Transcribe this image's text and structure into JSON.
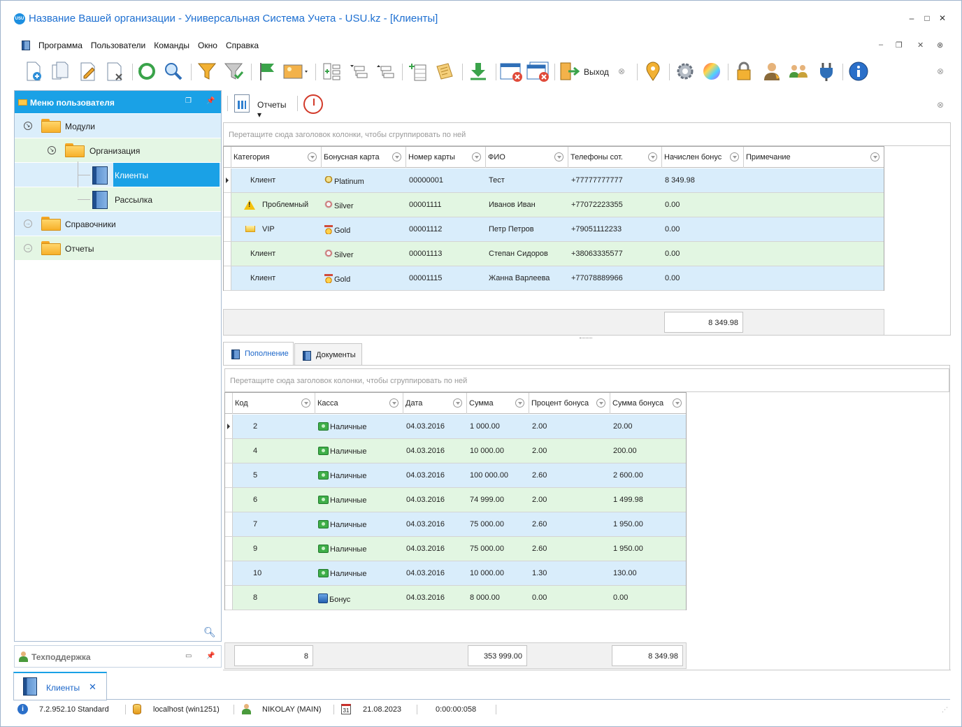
{
  "window": {
    "title": "Название Вашей организации - Универсальная Система Учета - USU.kz - [Клиенты]",
    "logo_text": "USU"
  },
  "menu": {
    "items": [
      "Программа",
      "Пользователи",
      "Команды",
      "Окно",
      "Справка"
    ]
  },
  "toolbar": {
    "icons": [
      "add-icon",
      "copy-icon",
      "edit-icon",
      "delete-icon",
      "refresh-icon",
      "search-icon",
      "filter-icon",
      "filter-check-icon",
      "flag-icon",
      "image-icon",
      "expand-tree-icon",
      "collapse-tree-icon",
      "tree-up-icon",
      "add-row-icon",
      "notes-icon",
      "download-icon",
      "close-window-icon",
      "close-all-windows-icon",
      "exit-icon",
      "map-pin-icon",
      "settings-gear-icon",
      "color-wheel-icon",
      "lock-icon",
      "user-icon",
      "users-group-icon",
      "plugin-icon",
      "info-icon"
    ],
    "exit_label": "Выход"
  },
  "left_panel": {
    "title": "Меню пользователя",
    "tree": {
      "modules": "Модули",
      "organization": "Организация",
      "clients": "Клиенты",
      "mailing": "Рассылка",
      "references": "Справочники",
      "reports": "Отчеты"
    },
    "support_title": "Техподдержка"
  },
  "subtoolbar": {
    "reports_label": "Отчеты"
  },
  "clients_grid": {
    "group_hint": "Перетащите сюда заголовок колонки, чтобы сгруппировать по ней",
    "columns": [
      "Категория",
      "Бонусная карта",
      "Номер карты",
      "ФИО",
      "Телефоны сот.",
      "Начислен бонус",
      "Примечание"
    ],
    "rows": [
      {
        "category": "Клиент",
        "category_icon": "",
        "card": "Platinum",
        "card_icon": "platinum-trophy-icon",
        "number": "00000001",
        "name": "Тест",
        "phone": "+77777777777",
        "bonus": "8 349.98",
        "note": ""
      },
      {
        "category": "Проблемный",
        "category_icon": "warning-icon",
        "card": "Silver",
        "card_icon": "silver-medal-icon",
        "number": "00001111",
        "name": "Иванов Иван",
        "phone": "+77072223355",
        "bonus": "0.00",
        "note": ""
      },
      {
        "category": "VIP",
        "category_icon": "crown-icon",
        "card": "Gold",
        "card_icon": "gold-medal-icon",
        "number": "00001112",
        "name": "Петр Петров",
        "phone": "+79051112233",
        "bonus": "0.00",
        "note": ""
      },
      {
        "category": "Клиент",
        "category_icon": "",
        "card": "Silver",
        "card_icon": "silver-medal-icon",
        "number": "00001113",
        "name": "Степан Сидоров",
        "phone": "+38063335577",
        "bonus": "0.00",
        "note": ""
      },
      {
        "category": "Клиент",
        "category_icon": "",
        "card": "Gold",
        "card_icon": "gold-medal-icon",
        "number": "00001115",
        "name": "Жанна Варлеева",
        "phone": "+77078889966",
        "bonus": "0.00",
        "note": ""
      }
    ],
    "total_bonus": "8 349.98"
  },
  "tabs": {
    "active": "Пополнение",
    "other": "Документы"
  },
  "topup_grid": {
    "group_hint": "Перетащите сюда заголовок колонки, чтобы сгруппировать по ней",
    "columns": [
      "Код",
      "Касса",
      "Дата",
      "Сумма",
      "Процент бонуса",
      "Сумма бонуса"
    ],
    "rows": [
      {
        "code": "2",
        "cash": "Наличные",
        "cash_icon": "cash-icon",
        "date": "04.03.2016",
        "amount": "1 000.00",
        "percent": "2.00",
        "bonus": "20.00"
      },
      {
        "code": "4",
        "cash": "Наличные",
        "cash_icon": "cash-icon",
        "date": "04.03.2016",
        "amount": "10 000.00",
        "percent": "2.00",
        "bonus": "200.00"
      },
      {
        "code": "5",
        "cash": "Наличные",
        "cash_icon": "cash-icon",
        "date": "04.03.2016",
        "amount": "100 000.00",
        "percent": "2.60",
        "bonus": "2 600.00"
      },
      {
        "code": "6",
        "cash": "Наличные",
        "cash_icon": "cash-icon",
        "date": "04.03.2016",
        "amount": "74 999.00",
        "percent": "2.00",
        "bonus": "1 499.98"
      },
      {
        "code": "7",
        "cash": "Наличные",
        "cash_icon": "cash-icon",
        "date": "04.03.2016",
        "amount": "75 000.00",
        "percent": "2.60",
        "bonus": "1 950.00"
      },
      {
        "code": "9",
        "cash": "Наличные",
        "cash_icon": "cash-icon",
        "date": "04.03.2016",
        "amount": "75 000.00",
        "percent": "2.60",
        "bonus": "1 950.00"
      },
      {
        "code": "10",
        "cash": "Наличные",
        "cash_icon": "cash-icon",
        "date": "04.03.2016",
        "amount": "10 000.00",
        "percent": "1.30",
        "bonus": "130.00"
      },
      {
        "code": "8",
        "cash": "Бонус",
        "cash_icon": "bonus-icon",
        "date": "04.03.2016",
        "amount": "8 000.00",
        "percent": "0.00",
        "bonus": "0.00"
      }
    ],
    "total_count": "8",
    "total_amount": "353 999.00",
    "total_bonus": "8 349.98"
  },
  "doc_tab": {
    "label": "Клиенты"
  },
  "statusbar": {
    "version": "7.2.952.10 Standard",
    "server": "localhost (win1251)",
    "user": "NIKOLAY (MAIN)",
    "date": "21.08.2023",
    "calendar_day": "31",
    "timer": "0:00:00:058"
  },
  "colors": {
    "accent": "#1aa1e6",
    "title": "#1d6fd1",
    "row_blue": "#d9edfb",
    "row_green": "#e2f6e2"
  }
}
